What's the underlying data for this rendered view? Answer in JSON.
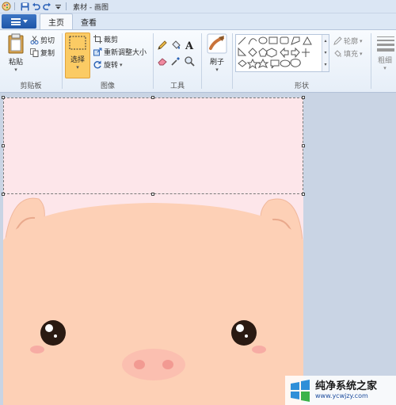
{
  "window": {
    "title": "素材 - 画图"
  },
  "tabs": [
    {
      "label": "主页",
      "active": true
    },
    {
      "label": "查看",
      "active": false
    }
  ],
  "clipboard": {
    "paste": "粘贴",
    "cut": "剪切",
    "copy": "复制",
    "group": "剪贴板"
  },
  "image": {
    "select": "选择",
    "crop": "裁剪",
    "resize": "重新调整大小",
    "rotate": "旋转",
    "group": "图像"
  },
  "tools": {
    "group": "工具"
  },
  "brushes": {
    "label": "刷子"
  },
  "shapes": {
    "group": "形状",
    "outline": "轮廓",
    "fill": "填充"
  },
  "size": {
    "label": "粗细"
  },
  "watermark": {
    "name": "纯净系统之家",
    "url": "www.ycwjzy.com"
  },
  "colors": {
    "accent": "#1d55a8",
    "canvas_bg": "#fde6ea",
    "pig_face": "#fdd0b6",
    "pig_outline": "#f2b8a0",
    "selected": "#fbcb64"
  }
}
